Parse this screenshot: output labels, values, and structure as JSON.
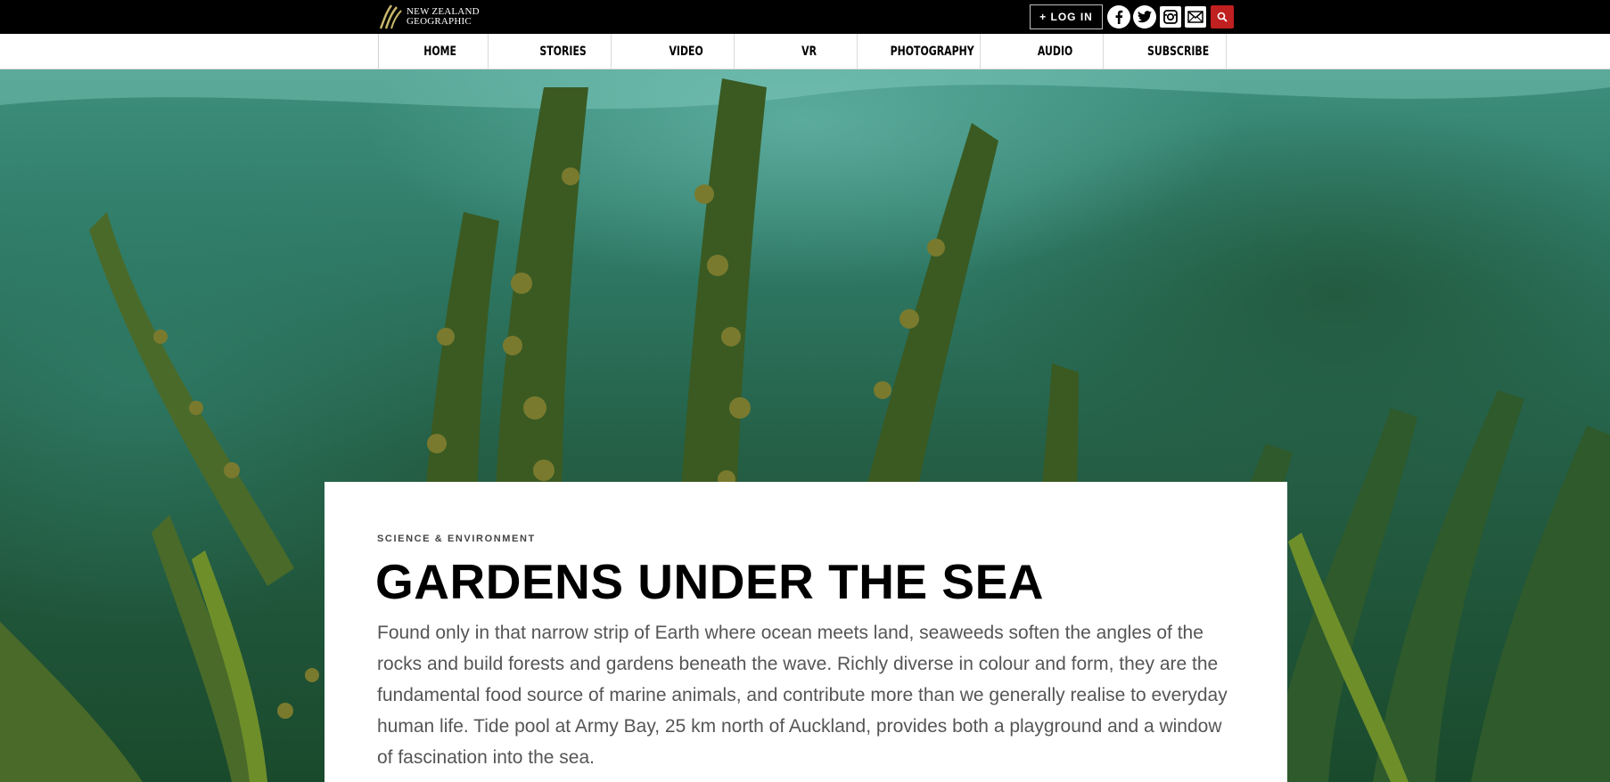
{
  "brand": {
    "logo_line1": "NEW ZEALAND",
    "logo_line2": "GEOGRAPHIC",
    "accent": "#c0201f"
  },
  "header": {
    "login_label": "+ LOG IN",
    "social_icons": [
      "facebook-icon",
      "twitter-icon",
      "instagram-icon",
      "email-icon"
    ],
    "search_icon": "search-icon"
  },
  "nav": {
    "items": [
      "HOME",
      "STORIES",
      "VIDEO",
      "VR",
      "PHOTOGRAPHY",
      "AUDIO",
      "SUBSCRIBE"
    ]
  },
  "article": {
    "category": "SCIENCE & ENVIRONMENT",
    "title": "GARDENS UNDER THE SEA",
    "lede": "Found only in that narrow strip of Earth where ocean meets land, seaweeds soften the angles of the rocks and build forests and gardens beneath the wave. Richly diverse in colour and form, they are the fundamental food source of marine animals, and contribute more than we generally realise to everyday human life. Tide pool at Army Bay, 25 km north of Auckland, provides both a playground and a window of fascination into the sea."
  }
}
